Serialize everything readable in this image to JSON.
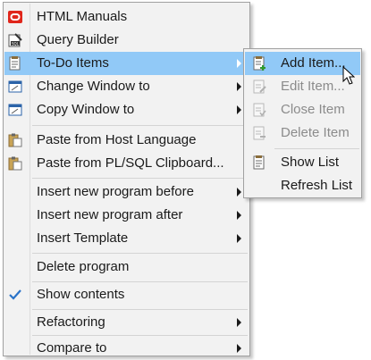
{
  "main_menu": {
    "items": [
      {
        "label": "HTML Manuals",
        "icon": "oracle-icon"
      },
      {
        "label": "Query Builder",
        "icon": "query-builder-icon"
      },
      {
        "label": "To-Do Items",
        "icon": "todo-icon",
        "submenu": true,
        "highlighted": true
      },
      {
        "label": "Change Window to",
        "icon": "window-icon",
        "submenu": true
      },
      {
        "label": "Copy Window to",
        "icon": "window-icon",
        "submenu": true
      },
      {
        "label": "Paste from Host Language",
        "icon": "clipboard-icon"
      },
      {
        "label": "Paste from PL/SQL Clipboard...",
        "icon": "clipboard-icon"
      },
      {
        "label": "Insert new program before",
        "submenu": true
      },
      {
        "label": "Insert new program after",
        "submenu": true
      },
      {
        "label": "Insert Template",
        "submenu": true
      },
      {
        "label": "Delete program"
      },
      {
        "label": "Show contents",
        "checked": true
      },
      {
        "label": "Refactoring",
        "submenu": true
      },
      {
        "label": "Compare to",
        "submenu": true
      }
    ]
  },
  "todo_submenu": {
    "items": [
      {
        "label": "Add Item...",
        "icon": "add-item-icon",
        "highlighted": true
      },
      {
        "label": "Edit Item...",
        "icon": "edit-item-icon",
        "disabled": true
      },
      {
        "label": "Close Item",
        "icon": "close-item-icon",
        "disabled": true
      },
      {
        "label": "Delete Item",
        "icon": "delete-item-icon",
        "disabled": true
      },
      {
        "label": "Show List",
        "icon": "show-list-icon"
      },
      {
        "label": "Refresh List"
      }
    ]
  },
  "colors": {
    "highlight": "#91c9f7",
    "menu_background": "#f2f2f2",
    "oracle_red": "#e0261b",
    "check_blue": "#2a73c8"
  }
}
